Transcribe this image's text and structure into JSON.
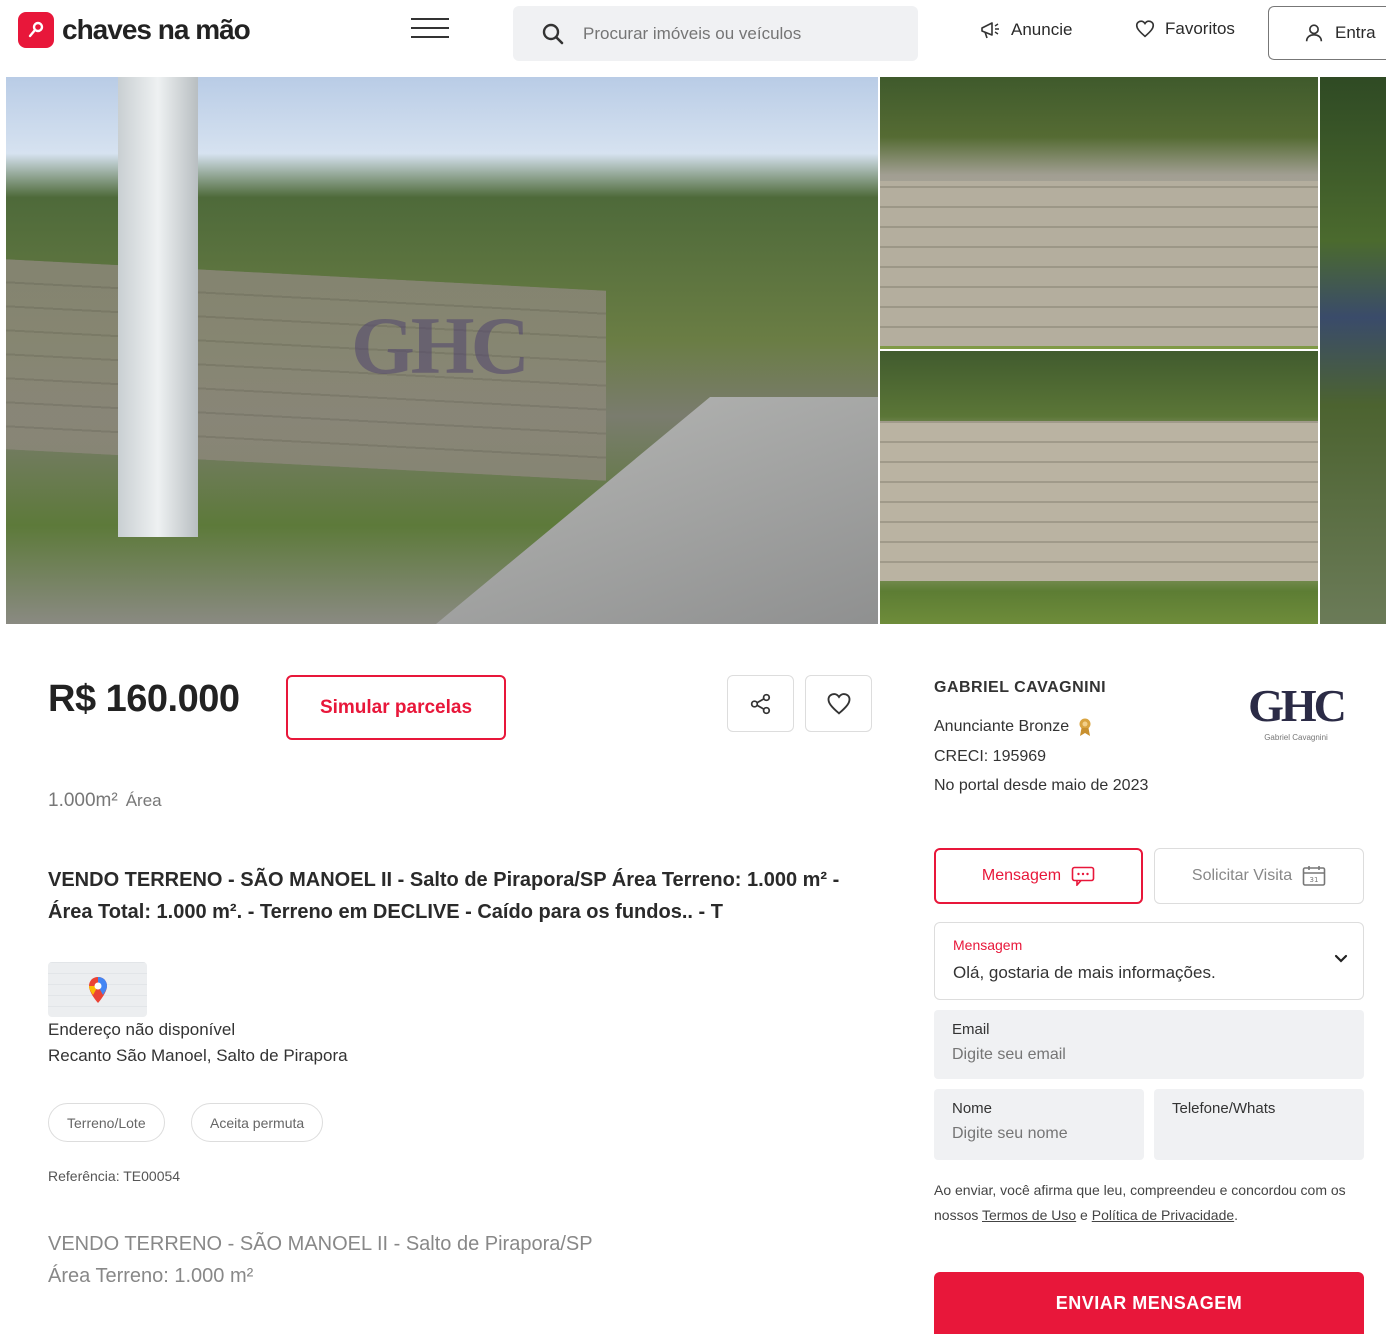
{
  "header": {
    "logo_text": "chaves na mão",
    "search_placeholder": "Procurar imóveis ou veículos",
    "anuncie_label": "Anuncie",
    "favoritos_label": "Favoritos",
    "entrar_label": "Entra"
  },
  "gallery": {
    "watermark": "GHC"
  },
  "listing": {
    "price": "R$ 160.000",
    "simulate_label": "Simular parcelas",
    "area_value": "1.000m²",
    "area_label": "Área",
    "title": "VENDO TERRENO - SÃO MANOEL II - Salto de Pirapora/SP Área Terreno: 1.000 m² - Área Total: 1.000 m². - Terreno em DECLIVE - Caído para os fundos.. - T",
    "address_line1": "Endereço não disponível",
    "address_line2": "Recanto São Manoel, Salto de Pirapora",
    "tags": [
      "Terreno/Lote",
      "Aceita permuta"
    ],
    "reference": "Referência: TE00054",
    "description_line1": "VENDO TERRENO - SÃO MANOEL II - Salto de Pirapora/SP",
    "description_line2": "Área Terreno: 1.000 m²"
  },
  "agent": {
    "name": "GABRIEL CAVAGNINI",
    "level": "Anunciante Bronze",
    "creci": "CRECI: 195969",
    "since": "No portal desde maio de 2023",
    "logo_text": "GHC",
    "logo_subtext": "Gabriel Cavagnini"
  },
  "contact": {
    "tab_message": "Mensagem",
    "tab_visit": "Solicitar Visita",
    "select_label": "Mensagem",
    "select_value": "Olá, gostaria de mais informações.",
    "email_label": "Email",
    "email_placeholder": "Digite seu email",
    "name_label": "Nome",
    "name_placeholder": "Digite seu nome",
    "phone_label": "Telefone/Whats",
    "legal_prefix": "Ao enviar, você afirma que leu, compreendeu e concordou com os nossos",
    "terms_link": "Termos de Uso",
    "legal_and": "e",
    "privacy_link": "Política de Privacidade",
    "legal_suffix": ".",
    "send_label": "ENVIAR MENSAGEM"
  },
  "colors": {
    "brand": "#e8173a",
    "text": "#2a2a2a",
    "field_bg": "#f0f1f3"
  },
  "icons": [
    "key-logo-icon",
    "hamburger-icon",
    "search-icon",
    "megaphone-icon",
    "heart-icon",
    "user-icon",
    "share-icon",
    "map-pin-icon",
    "medal-icon",
    "chat-icon",
    "calendar-icon",
    "chevron-down-icon"
  ]
}
